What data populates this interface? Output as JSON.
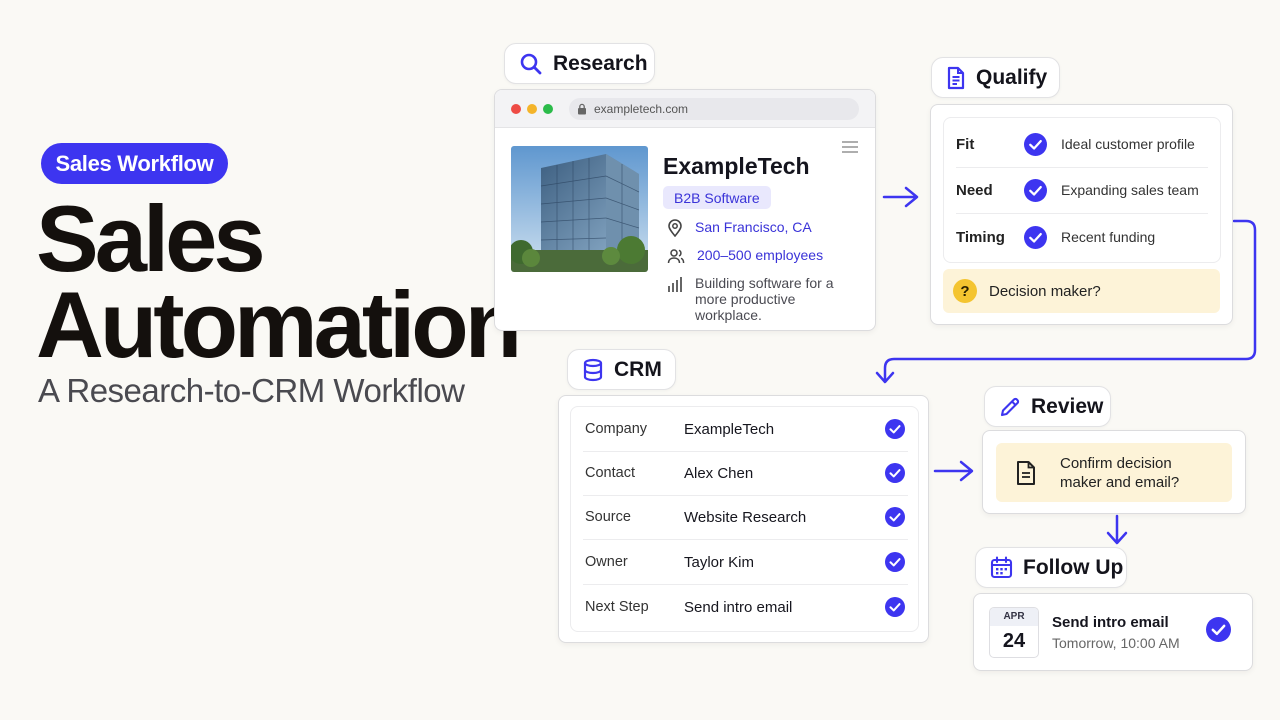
{
  "hero": {
    "badge": "Sales Workflow",
    "title_line1": "Sales",
    "title_line2": "Automation",
    "subtitle": "A Research-to-CRM Workflow"
  },
  "research": {
    "label": "Research",
    "url": "exampletech.com",
    "company": "ExampleTech",
    "tag": "B2B Software",
    "location": "San Francisco, CA",
    "employees": "200–500 employees",
    "description": "Building software for a more productive workplace."
  },
  "qualify": {
    "label": "Qualify",
    "rows": [
      {
        "key": "Fit",
        "value": "Ideal customer profile"
      },
      {
        "key": "Need",
        "value": "Expanding sales team"
      },
      {
        "key": "Timing",
        "value": "Recent funding"
      }
    ],
    "question_mark": "?",
    "question": "Decision maker?"
  },
  "crm": {
    "label": "CRM",
    "rows": [
      {
        "key": "Company",
        "value": "ExampleTech"
      },
      {
        "key": "Contact",
        "value": "Alex Chen"
      },
      {
        "key": "Source",
        "value": "Website Research"
      },
      {
        "key": "Owner",
        "value": "Taylor Kim"
      },
      {
        "key": "Next Step",
        "value": "Send intro email"
      }
    ]
  },
  "review": {
    "label": "Review",
    "line1": "Confirm decision",
    "line2": "maker and email?"
  },
  "follow_up": {
    "label": "Follow Up",
    "month": "APR",
    "day": "24",
    "title": "Send intro email",
    "time": "Tomorrow, 10:00 AM"
  },
  "colors": {
    "accent": "#3d35f0",
    "highlight": "#fdf3d8",
    "background": "#faf9f5"
  }
}
